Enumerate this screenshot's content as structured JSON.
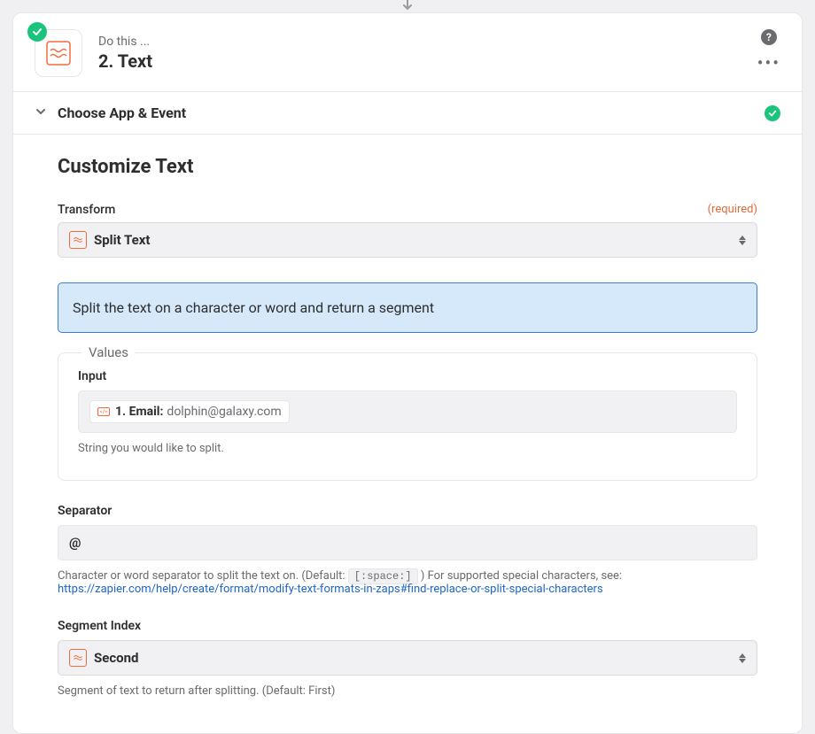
{
  "header": {
    "kicker": "Do this ...",
    "title": "2. Text"
  },
  "section": {
    "choose_label": "Choose App & Event"
  },
  "panel": {
    "title": "Customize Text"
  },
  "transform": {
    "label": "Transform",
    "required": "(required)",
    "value": "Split Text",
    "description": "Split the text on a character or word and return a segment"
  },
  "values": {
    "legend": "Values",
    "input": {
      "label": "Input",
      "pill_prefix": "1. Email:",
      "pill_value": "dolphin@galaxy.com",
      "help": "String you would like to split."
    }
  },
  "separator": {
    "label": "Separator",
    "value": "@",
    "help_prefix": "Character or word separator to split the text on. (Default:",
    "help_default": "[:space:]",
    "help_suffix": ") For supported special characters, see:",
    "help_link": "https://zapier.com/help/create/format/modify-text-formats-in-zaps#find-replace-or-split-special-characters"
  },
  "segment": {
    "label": "Segment Index",
    "value": "Second",
    "help": "Segment of text to return after splitting. (Default: First)"
  }
}
